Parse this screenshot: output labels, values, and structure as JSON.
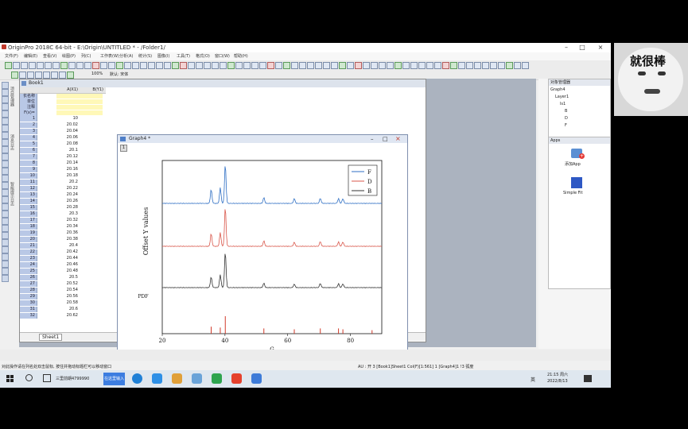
{
  "app": {
    "title": "OriginPro 2018C 64-bit - E:\\Origin\\UNTITLED * - /Folder1/",
    "menus": [
      "文件(F)",
      "编辑(E)",
      "查看(V)",
      "绘图(P)",
      "列(C)",
      "工作表(W)",
      "分析(A)",
      "统计(S)",
      "图像(I)",
      "工具(T)",
      "格式(O)",
      "窗口(W)",
      "帮助(H)"
    ]
  },
  "toolbar": {
    "zoom": "100%",
    "font": "默认: 宋体",
    "font_size": "0"
  },
  "book": {
    "title": "Book1"
  },
  "sheet": {
    "col_a": "A(X1)",
    "col_b": "B(Y1)",
    "meta_rows": [
      "长名称",
      "单位",
      "注释",
      "F(x)="
    ],
    "rows": [
      [
        "1",
        "10"
      ],
      [
        "2",
        "20.02"
      ],
      [
        "3",
        "20.04"
      ],
      [
        "4",
        "20.06"
      ],
      [
        "5",
        "20.08"
      ],
      [
        "6",
        "20.1"
      ],
      [
        "7",
        "20.12"
      ],
      [
        "8",
        "20.14"
      ],
      [
        "9",
        "20.16"
      ],
      [
        "10",
        "20.18"
      ],
      [
        "11",
        "20.2"
      ],
      [
        "12",
        "20.22"
      ],
      [
        "13",
        "20.24"
      ],
      [
        "14",
        "20.26"
      ],
      [
        "15",
        "20.28"
      ],
      [
        "16",
        "20.3"
      ],
      [
        "17",
        "20.32"
      ],
      [
        "18",
        "20.34"
      ],
      [
        "19",
        "20.36"
      ],
      [
        "20",
        "20.38"
      ],
      [
        "21",
        "20.4"
      ],
      [
        "22",
        "20.42"
      ],
      [
        "23",
        "20.44"
      ],
      [
        "24",
        "20.46"
      ],
      [
        "25",
        "20.48"
      ],
      [
        "26",
        "20.5"
      ],
      [
        "27",
        "20.52"
      ],
      [
        "28",
        "20.54"
      ],
      [
        "29",
        "20.56"
      ],
      [
        "30",
        "20.58"
      ],
      [
        "31",
        "20.6"
      ],
      [
        "32",
        "20.62"
      ]
    ],
    "tab": "Sheet1"
  },
  "graph": {
    "title": "Graph4 *",
    "layer": "1"
  },
  "chart_data": {
    "type": "line",
    "xlabel": "G",
    "ylabel": "Offset Y values",
    "xlim": [
      20,
      90
    ],
    "x_ticks": [
      "20",
      "40",
      "60",
      "80"
    ],
    "legend_position": "top-right",
    "legend": [
      "F",
      "D",
      "B"
    ],
    "side_label": "PDF",
    "series": [
      {
        "name": "F",
        "color": "#2f6fc4",
        "offset": 3,
        "peaks": [
          [
            35.6,
            0.35
          ],
          [
            38.5,
            0.4
          ],
          [
            40.1,
            1.0
          ],
          [
            52.4,
            0.15
          ],
          [
            62.1,
            0.12
          ],
          [
            70.4,
            0.13
          ],
          [
            76.2,
            0.12
          ],
          [
            77.6,
            0.12
          ]
        ]
      },
      {
        "name": "D",
        "color": "#d9574b",
        "offset": 2,
        "peaks": [
          [
            35.6,
            0.32
          ],
          [
            38.5,
            0.35
          ],
          [
            40.1,
            1.0
          ],
          [
            52.4,
            0.14
          ],
          [
            62.1,
            0.1
          ],
          [
            70.4,
            0.12
          ],
          [
            76.2,
            0.11
          ],
          [
            77.6,
            0.11
          ]
        ]
      },
      {
        "name": "B",
        "color": "#333333",
        "offset": 1,
        "peaks": [
          [
            35.6,
            0.28
          ],
          [
            38.5,
            0.34
          ],
          [
            40.1,
            0.95
          ],
          [
            52.4,
            0.12
          ],
          [
            62.1,
            0.09
          ],
          [
            70.4,
            0.11
          ],
          [
            76.2,
            0.1
          ],
          [
            77.6,
            0.1
          ]
        ]
      },
      {
        "name": "PDF",
        "color": "#d03a2a",
        "offset": 0,
        "type": "stick",
        "peaks": [
          [
            35.6,
            0.4
          ],
          [
            38.5,
            0.35
          ],
          [
            40.1,
            1.0
          ],
          [
            52.4,
            0.3
          ],
          [
            62.1,
            0.25
          ],
          [
            70.4,
            0.3
          ],
          [
            76.2,
            0.3
          ],
          [
            77.6,
            0.25
          ],
          [
            86.9,
            0.2
          ]
        ]
      }
    ]
  },
  "object_manager": {
    "title": "对象管理器",
    "items": [
      "Graph4",
      "Layer1",
      "ls1",
      "B",
      "D",
      "F"
    ]
  },
  "apps": {
    "title": "Apps",
    "items": [
      "添加App",
      "Simple Fit"
    ]
  },
  "status": {
    "left": "对此操作请在列名处双击鼠标, 按住并拖动标题栏可以移动窗口",
    "right": "AU : 开    3 [Book1]Sheet1 Col(F)[1:561]    1 [Graph4]1 !3    弧度"
  },
  "taskbar": {
    "search": "在这里输入",
    "app": "三里前期4799990",
    "time": "21:15 周六",
    "date": "2022/8/13",
    "ime": "英"
  },
  "webcam": {
    "text": "就很棒"
  }
}
